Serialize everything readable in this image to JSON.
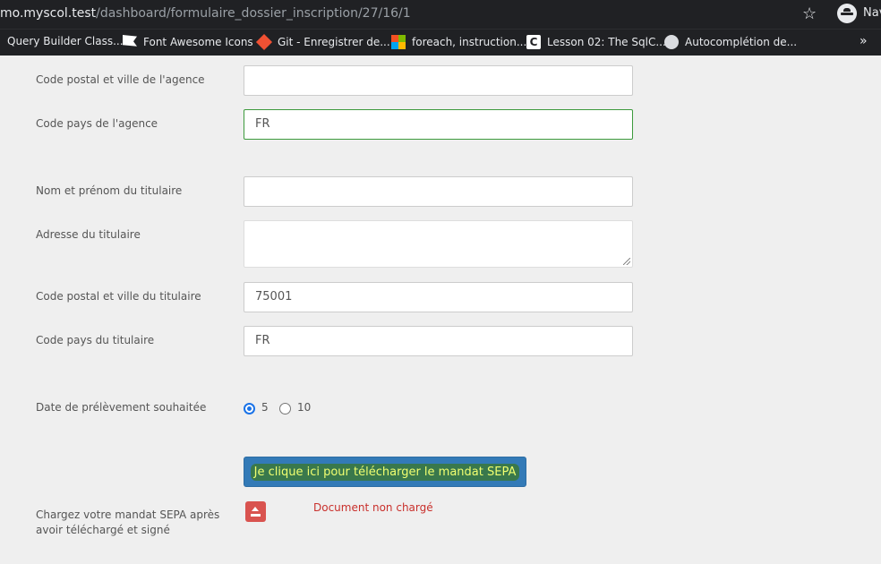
{
  "browser": {
    "url_host": "mo.myscol.test",
    "url_path": "/dashboard/formulaire_dossier_inscription/27/16/1",
    "profile_label": "Nav",
    "bookmarks": [
      {
        "label": "Query Builder Class...",
        "icon": "none"
      },
      {
        "label": "Font Awesome Icons",
        "icon": "flag-icon"
      },
      {
        "label": "Git - Enregistrer de...",
        "icon": "git-icon"
      },
      {
        "label": "foreach, instruction...",
        "icon": "microsoft-icon"
      },
      {
        "label": "Lesson 02: The SqlC...",
        "icon": "c-icon"
      },
      {
        "label": "Autocomplétion de...",
        "icon": "globe-icon"
      }
    ],
    "overflow": "»"
  },
  "form": {
    "agency_zip_city": {
      "label": "Code postal et ville de l'agence",
      "value": ""
    },
    "agency_country": {
      "label": "Code pays de l'agence",
      "value": "FR"
    },
    "holder_name": {
      "label": "Nom et prénom du titulaire",
      "value": ""
    },
    "holder_address": {
      "label": "Adresse du titulaire",
      "value": ""
    },
    "holder_zip_city": {
      "label": "Code postal et ville du titulaire",
      "value": "75001"
    },
    "holder_country": {
      "label": "Code pays du titulaire",
      "value": "FR"
    },
    "debit_date": {
      "label": "Date de prélèvement souhaitée",
      "options": [
        "5",
        "10"
      ],
      "selected": "5"
    },
    "download_button": "Je clique ici pour télécharger le mandat SEPA",
    "upload": {
      "label_line1": "Chargez votre mandat SEPA après",
      "label_line2": "avoir téléchargé et signé",
      "status": "Document non chargé",
      "status_color": "#c9302c"
    }
  },
  "colors": {
    "chrome_bg": "#202124",
    "page_bg": "#efefef",
    "primary_button": "#337ab7",
    "danger": "#d9534f",
    "valid_border": "#3c9a3c"
  }
}
